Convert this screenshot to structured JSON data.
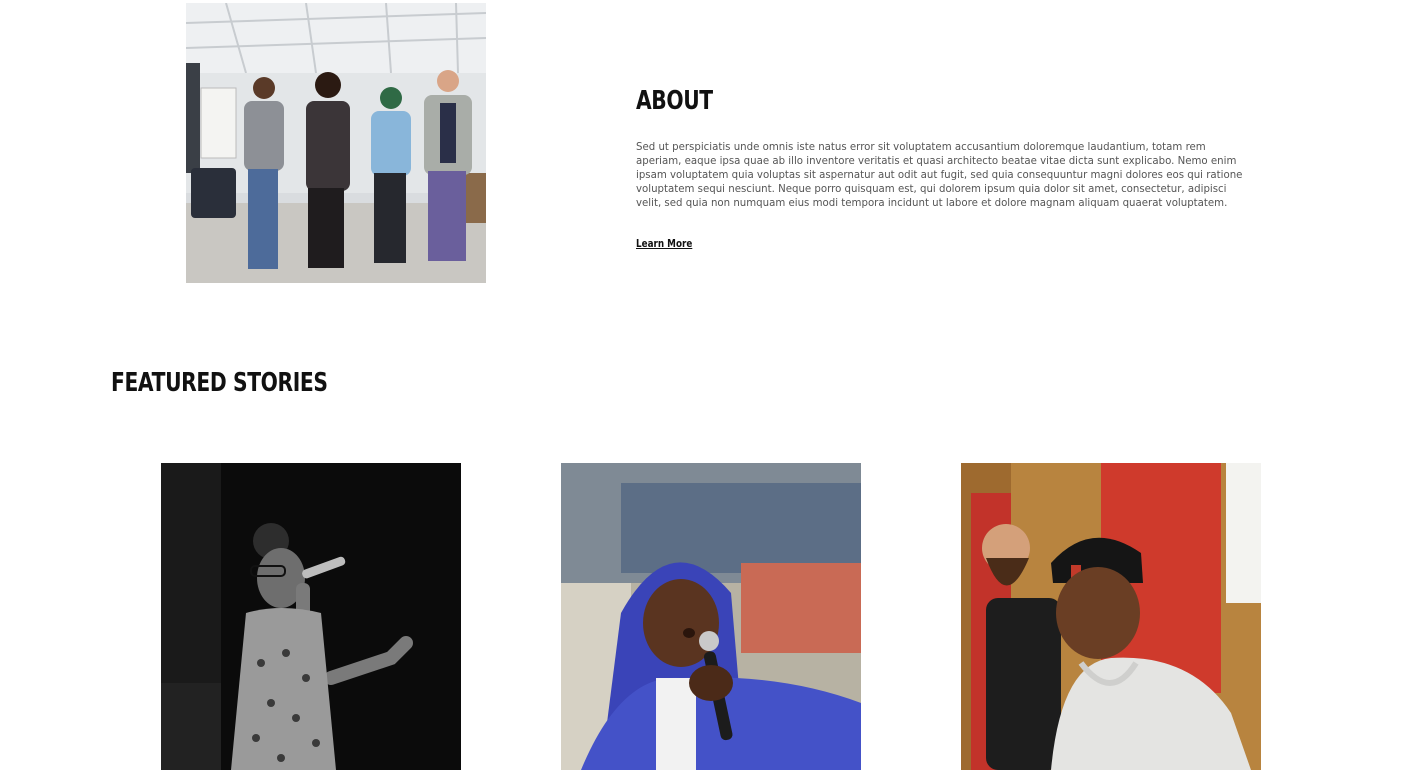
{
  "about": {
    "title": "ABOUT",
    "body": "Sed ut perspiciatis unde omnis iste natus error sit voluptatem accusantium doloremque laudantium, totam rem aperiam, eaque ipsa quae ab illo inventore veritatis et quasi architecto beatae vitae dicta sunt explicabo. Nemo enim ipsam voluptatem quia voluptas sit aspernatur aut odit aut fugit, sed quia consequuntur magni dolores eos qui ratione voluptatem sequi nesciunt. Neque porro quisquam est, qui dolorem ipsum quia dolor sit amet, consectetur, adipisci velit, sed quia non numquam eius modi tempora incidunt ut labore et dolore magnam aliquam quaerat voluptatem.",
    "link_label": "Learn More",
    "photo_icon": "group-photo-image"
  },
  "featured": {
    "title": "FEATURED STORIES",
    "stories": [
      {
        "image": "singer-bw-photo"
      },
      {
        "image": "hooded-singer-photo"
      },
      {
        "image": "two-men-portrait-photo"
      }
    ]
  },
  "colors": {
    "text_heading": "#111111",
    "text_body": "#555555",
    "background": "#ffffff"
  }
}
